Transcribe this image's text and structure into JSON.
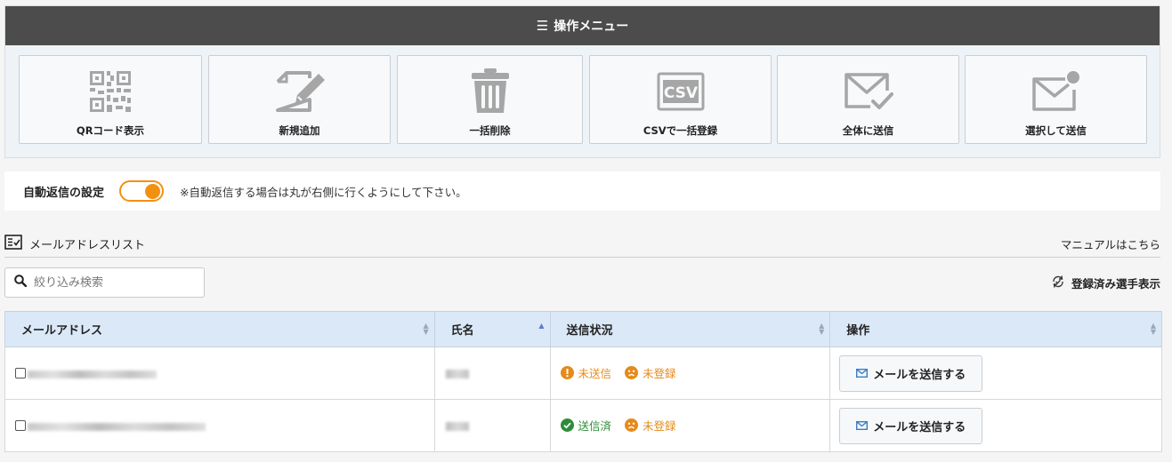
{
  "menu": {
    "title": "操作メニュー",
    "buttons": [
      {
        "label": "QRコード表示",
        "icon": "qr-code-icon"
      },
      {
        "label": "新規追加",
        "icon": "edit-document-icon"
      },
      {
        "label": "一括削除",
        "icon": "trash-icon"
      },
      {
        "label": "CSVで一括登録",
        "icon": "csv-file-icon"
      },
      {
        "label": "全体に送信",
        "icon": "mail-check-icon"
      },
      {
        "label": "選択して送信",
        "icon": "mail-notify-icon"
      }
    ]
  },
  "auto_reply": {
    "title": "自動返信の設定",
    "enabled": true,
    "note": "※自動返信する場合は丸が右側に行くようにして下さい。"
  },
  "list": {
    "title": "メールアドレスリスト",
    "manual_link": "マニュアルはこちら",
    "search_placeholder": "絞り込み検索",
    "registered_toggle": "登録済み選手表示"
  },
  "table": {
    "headers": [
      "メールアドレス",
      "氏名",
      "送信状況",
      "操作"
    ],
    "rows": [
      {
        "status1": "未送信",
        "status2": "未登録",
        "action": "メールを送信する"
      },
      {
        "status1": "送信済",
        "status2": "未登録",
        "action": "メールを送信する"
      }
    ]
  },
  "colors": {
    "accent_orange": "#f29111",
    "header_dark": "#4c4c4c",
    "table_header": "#dbe8f7",
    "status_green": "#2e8b3a"
  }
}
